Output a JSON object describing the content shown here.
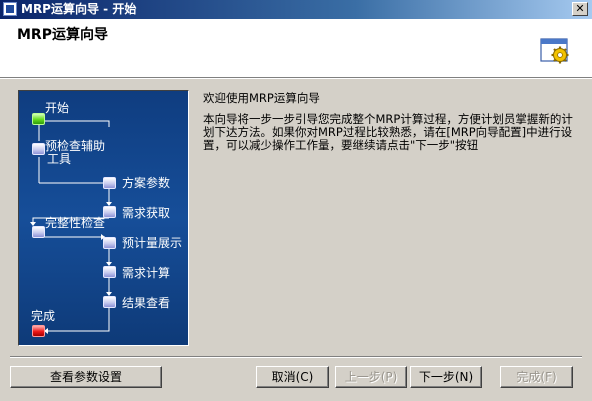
{
  "window": {
    "title": "MRP运算向导 - 开始",
    "close_label": "✕"
  },
  "header": {
    "title": "MRP运算向导",
    "icon": "wizard-gear-icon"
  },
  "flow": {
    "steps": [
      {
        "label": "开始",
        "marker": "green"
      },
      {
        "label": "预检查辅助",
        "label2": "工具",
        "marker": "white"
      },
      {
        "label": "方案参数",
        "marker": "white"
      },
      {
        "label": "需求获取",
        "marker": "white"
      },
      {
        "label": "完整性检查",
        "marker": "white"
      },
      {
        "label": "预计量展示",
        "marker": "white"
      },
      {
        "label": "需求计算",
        "marker": "white"
      },
      {
        "label": "结果查看",
        "marker": "white"
      },
      {
        "label": "完成",
        "marker": "red"
      }
    ]
  },
  "content": {
    "welcome": "欢迎使用MRP运算向导",
    "description": "本向导将一步一步引导您完成整个MRP计算过程，方便计划员掌握新的计划下达方法。如果你对MRP过程比较熟悉，请在[MRP向导配置]中进行设置，可以减少操作工作量，要继续请点击\"下一步\"按钮"
  },
  "footer": {
    "view_params_label": "查看参数设置",
    "cancel_label": "取消(C)",
    "back_label": "上一步(P)",
    "next_label": "下一步(N)",
    "finish_label": "完成(F)"
  },
  "colors": {
    "titlebar": "#0a246a",
    "panel": "#164e99",
    "start_marker": "#64dc1c",
    "end_marker": "#f01818"
  }
}
